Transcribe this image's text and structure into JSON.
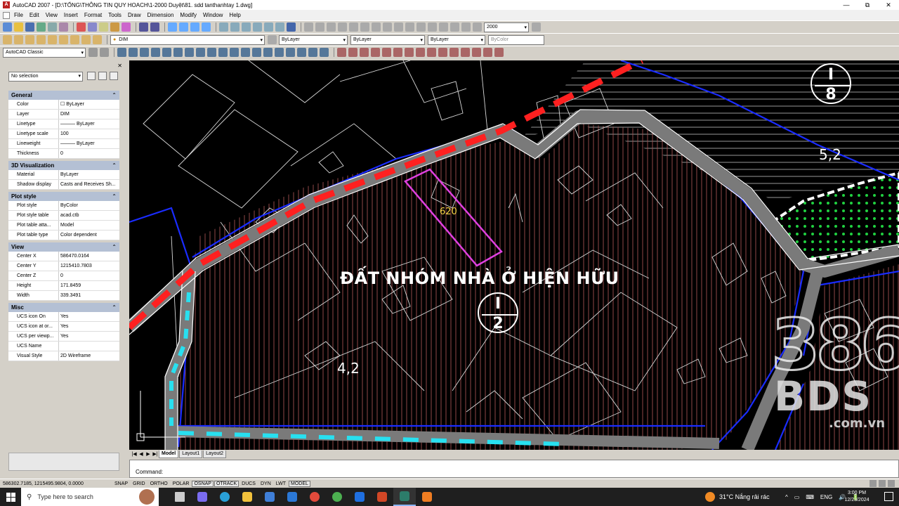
{
  "window": {
    "app_icon": "A",
    "title": "AutoCAD 2007 - [D:\\TỔNG\\THÔNG TIN QUY HOACH\\1-2000 Duyệt\\81. sdd tanthanhtay 1.dwg]",
    "controls": [
      "—",
      "⧉",
      "✕"
    ]
  },
  "menu": [
    "File",
    "Edit",
    "View",
    "Insert",
    "Format",
    "Tools",
    "Draw",
    "Dimension",
    "Modify",
    "Window",
    "Help"
  ],
  "toolbars": {
    "scale_combo": "2000",
    "layer_combo": "DIM",
    "color_combo": "ByLayer",
    "linetype_combo": "ByLayer",
    "lineweight_combo": "ByLayer",
    "plotstyle_combo": "ByColor",
    "workspace_combo": "AutoCAD Classic"
  },
  "properties": {
    "selection": "No selection",
    "sections": [
      {
        "title": "General",
        "rows": [
          {
            "key": "Color",
            "value": "☐ ByLayer"
          },
          {
            "key": "Layer",
            "value": "DIM"
          },
          {
            "key": "Linetype",
            "value": "——— ByLayer"
          },
          {
            "key": "Linetype scale",
            "value": "100"
          },
          {
            "key": "Lineweight",
            "value": "——— ByLayer"
          },
          {
            "key": "Thickness",
            "value": "0"
          }
        ]
      },
      {
        "title": "3D Visualization",
        "rows": [
          {
            "key": "Material",
            "value": "ByLayer"
          },
          {
            "key": "Shadow display",
            "value": "Casts and Receives Sh..."
          }
        ]
      },
      {
        "title": "Plot style",
        "rows": [
          {
            "key": "Plot style",
            "value": "ByColor"
          },
          {
            "key": "Plot style table",
            "value": "acad.ctb"
          },
          {
            "key": "Plot table atta...",
            "value": "Model"
          },
          {
            "key": "Plot table type",
            "value": "Color dependent"
          }
        ]
      },
      {
        "title": "View",
        "rows": [
          {
            "key": "Center X",
            "value": "586470.0164"
          },
          {
            "key": "Center Y",
            "value": "1215410.7803"
          },
          {
            "key": "Center Z",
            "value": "0"
          },
          {
            "key": "Height",
            "value": "171.8459"
          },
          {
            "key": "Width",
            "value": "339.3491"
          }
        ]
      },
      {
        "title": "Misc",
        "rows": [
          {
            "key": "UCS icon On",
            "value": "Yes"
          },
          {
            "key": "UCS icon at or...",
            "value": "Yes"
          },
          {
            "key": "UCS per viewp...",
            "value": "Yes"
          },
          {
            "key": "UCS Name",
            "value": ""
          },
          {
            "key": "Visual Style",
            "value": "2D Wireframe"
          }
        ]
      }
    ]
  },
  "drawing": {
    "main_label": "ĐẤT NHÓM NHÀ Ở HIỆN HỮU",
    "area_left": "4,2",
    "area_right": "5,2",
    "dimension": "620",
    "badge_main": {
      "top": "I",
      "bottom": "2"
    },
    "badge_corner": {
      "top": "I",
      "bottom": "8"
    },
    "watermark": {
      "number": "386",
      "brand": "BDS",
      "domain": ".com.vn"
    },
    "colors": {
      "road_red": "#ff2020",
      "road_cyan": "#28e0f0",
      "blue_line": "#1a2cff",
      "magenta": "#e040e0",
      "green": "#20d040",
      "hatch": "#a05050"
    }
  },
  "layout_tabs": {
    "nav": [
      "|◀",
      "◀",
      "▶",
      "▶|"
    ],
    "tabs": [
      "Model",
      "Layout1",
      "Layout2"
    ]
  },
  "command": {
    "prompt": "Command:"
  },
  "status": {
    "coords": "586302.7185, 1215495.9804, 0.0000",
    "buttons": [
      "SNAP",
      "GRID",
      "ORTHO",
      "POLAR",
      "OSNAP",
      "OTRACK",
      "DUCS",
      "DYN",
      "LWT",
      "MODEL"
    ]
  },
  "taskbar": {
    "search_placeholder": "Type here to search",
    "weather": "31°C  Nắng rải rác",
    "tray": [
      "^",
      "▭",
      "⌨",
      "ENG",
      "🔊",
      "🔋"
    ],
    "time": "3:00 PM",
    "date": "12/23/2024"
  }
}
